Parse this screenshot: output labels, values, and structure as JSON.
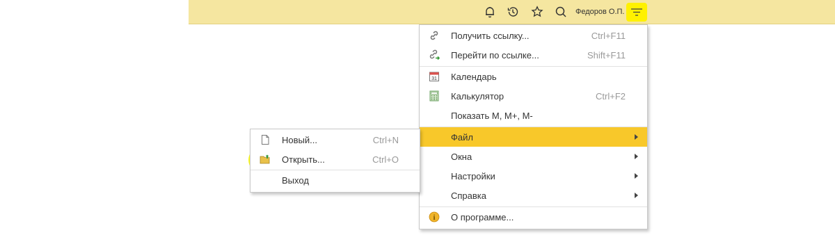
{
  "header": {
    "user_name": "Федоров О.П.",
    "icons": [
      "bell-icon",
      "history-icon",
      "star-icon",
      "search-icon",
      "menu-icon"
    ],
    "accent": "#f5e6a0"
  },
  "main_menu": {
    "items": [
      {
        "label": "Получить ссылку...",
        "shortcut": "Ctrl+F11",
        "icon": "link-icon"
      },
      {
        "label": "Перейти по ссылке...",
        "shortcut": "Shift+F11",
        "icon": "go-to-link-icon"
      },
      {
        "label": "Календарь",
        "shortcut": "",
        "icon": "calendar-icon",
        "icon_text": "31"
      },
      {
        "label": "Калькулятор",
        "shortcut": "Ctrl+F2",
        "icon": "calculator-icon"
      },
      {
        "label": "Показать M, M+, M-",
        "shortcut": ""
      },
      {
        "label": "Файл",
        "submenu": true,
        "active": true
      },
      {
        "label": "Окна",
        "submenu": true
      },
      {
        "label": "Настройки",
        "submenu": true
      },
      {
        "label": "Справка",
        "submenu": true
      },
      {
        "label": "О программе...",
        "shortcut": "",
        "icon": "info-icon",
        "icon_text": "i"
      }
    ],
    "active_color": "#f8c82a"
  },
  "file_submenu": {
    "items": [
      {
        "label": "Новый...",
        "shortcut": "Ctrl+N",
        "icon": "new-file-icon"
      },
      {
        "label": "Открыть...",
        "shortcut": "Ctrl+O",
        "icon": "open-folder-icon",
        "highlighted": true
      },
      {
        "label": "Выход",
        "shortcut": ""
      }
    ]
  }
}
